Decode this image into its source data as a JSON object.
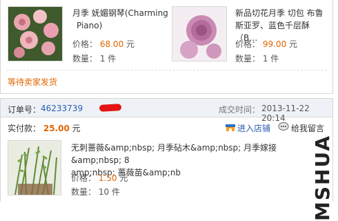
{
  "items_top": [
    {
      "title_line1": "月季 妩媚钢琴(Charming",
      "title_line2": "Piano)",
      "price_label": "价格：",
      "price": "68.00",
      "price_unit": "元",
      "qty_label": "数量：",
      "qty": "1 件",
      "image": "pink-rose-bouquet"
    },
    {
      "title_line1": "新品切花月季 切包 布鲁",
      "title_line2": "斯亚罗、蓝色千层酥（B…",
      "price_label": "价格：",
      "price": "99.00",
      "price_unit": "元",
      "qty_label": "数量：",
      "qty": "1 件",
      "image": "purple-rose"
    }
  ],
  "status": "等待卖家发货",
  "order": {
    "label": "订单号：",
    "number": "46233739",
    "time_label": "成交时间：",
    "time": "2013-11-22 20:14"
  },
  "payment": {
    "label": "实付款：",
    "amount": "25.00",
    "unit": "元"
  },
  "actions": {
    "enter_shop": "进入店铺",
    "leave_message": "给我留言"
  },
  "item_bottom": {
    "title_line1": "无刺蔷薇&amp;nbsp; 月季砧木&amp;nbsp; 月季嫁接&amp;nbsp; 8",
    "title_line2": "amp;nbsp; 蔷薇苗&amp;nb",
    "price_label": "价格：",
    "price": "1.50",
    "price_unit": "元",
    "qty_label": "数量：",
    "qty": "10 件",
    "image": "rose-rootstock-seedlings"
  },
  "watermark": "MSHUA"
}
